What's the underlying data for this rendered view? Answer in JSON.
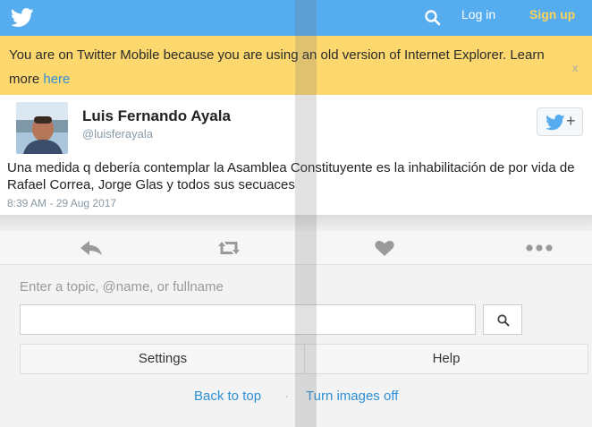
{
  "header": {
    "login_label": "Log in",
    "signup_label": "Sign up",
    "brand_color": "#55acee"
  },
  "notice": {
    "message": "You are on Twitter Mobile because you are using an old version of Internet Explorer. Learn more",
    "link_label": "here",
    "close_label": "x"
  },
  "tweet": {
    "author_name": "Luis Fernando Ayala",
    "author_handle": "@luisferayala",
    "follow_plus": "+",
    "text": "Una medida q debería contemplar la Asamblea Constituyente es la inhabilitación de por vida de Rafael Correa, Jorge Glas y todos sus secuaces",
    "timestamp": "8:39 AM - 29 Aug 2017"
  },
  "actions": [
    "reply-icon",
    "retweet-icon",
    "like-icon",
    "more-icon"
  ],
  "footer": {
    "search_hint": "Enter a topic, @name, or fullname",
    "search_value": "",
    "settings_label": "Settings",
    "help_label": "Help",
    "back_to_top_label": "Back to top",
    "separator": "·",
    "images_off_label": "Turn images off"
  }
}
